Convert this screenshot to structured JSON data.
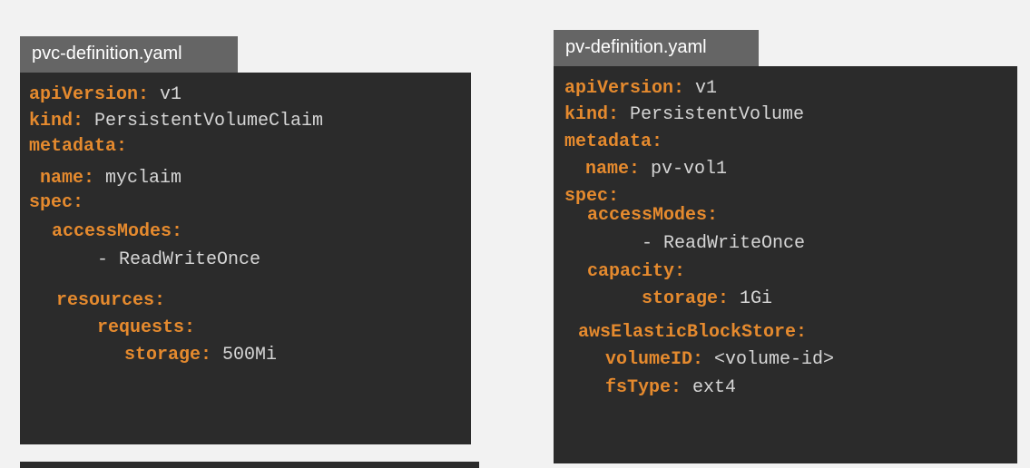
{
  "pvc": {
    "filename": "pvc-definition.yaml",
    "lines": [
      {
        "key": "apiVersion:",
        "value": " v1"
      },
      {
        "key": "kind:",
        "value": " PersistentVolumeClaim"
      },
      {
        "key": "metadata:",
        "value": ""
      },
      {
        "key": "name:",
        "value": " myclaim"
      },
      {
        "key": "spec:",
        "value": ""
      },
      {
        "key": "accessModes:",
        "value": ""
      },
      {
        "key": "",
        "value": "- ReadWriteOnce"
      },
      {
        "key": "resources:",
        "value": ""
      },
      {
        "key": "requests:",
        "value": ""
      },
      {
        "key": "storage:",
        "value": " 500Mi"
      }
    ]
  },
  "pv": {
    "filename": "pv-definition.yaml",
    "lines": [
      {
        "key": "apiVersion:",
        "value": " v1"
      },
      {
        "key": "kind:",
        "value": " PersistentVolume"
      },
      {
        "key": "metadata:",
        "value": ""
      },
      {
        "key": "name:",
        "value": " pv-vol1"
      },
      {
        "key": "spec:",
        "value": ""
      },
      {
        "key": "accessModes:",
        "value": ""
      },
      {
        "key": "",
        "value": "- ReadWriteOnce"
      },
      {
        "key": "capacity:",
        "value": ""
      },
      {
        "key": "storage:",
        "value": " 1Gi"
      },
      {
        "key": "awsElasticBlockStore:",
        "value": ""
      },
      {
        "key": "volumeID:",
        "value": " <volume-id>"
      },
      {
        "key": "fsType:",
        "value": " ext4"
      }
    ]
  },
  "colors": {
    "panel_bg": "#2b2b2b",
    "tab_bg": "#656565",
    "key": "#e58a2e",
    "value": "#d6d6d6",
    "page_bg": "#f2f2f2"
  }
}
